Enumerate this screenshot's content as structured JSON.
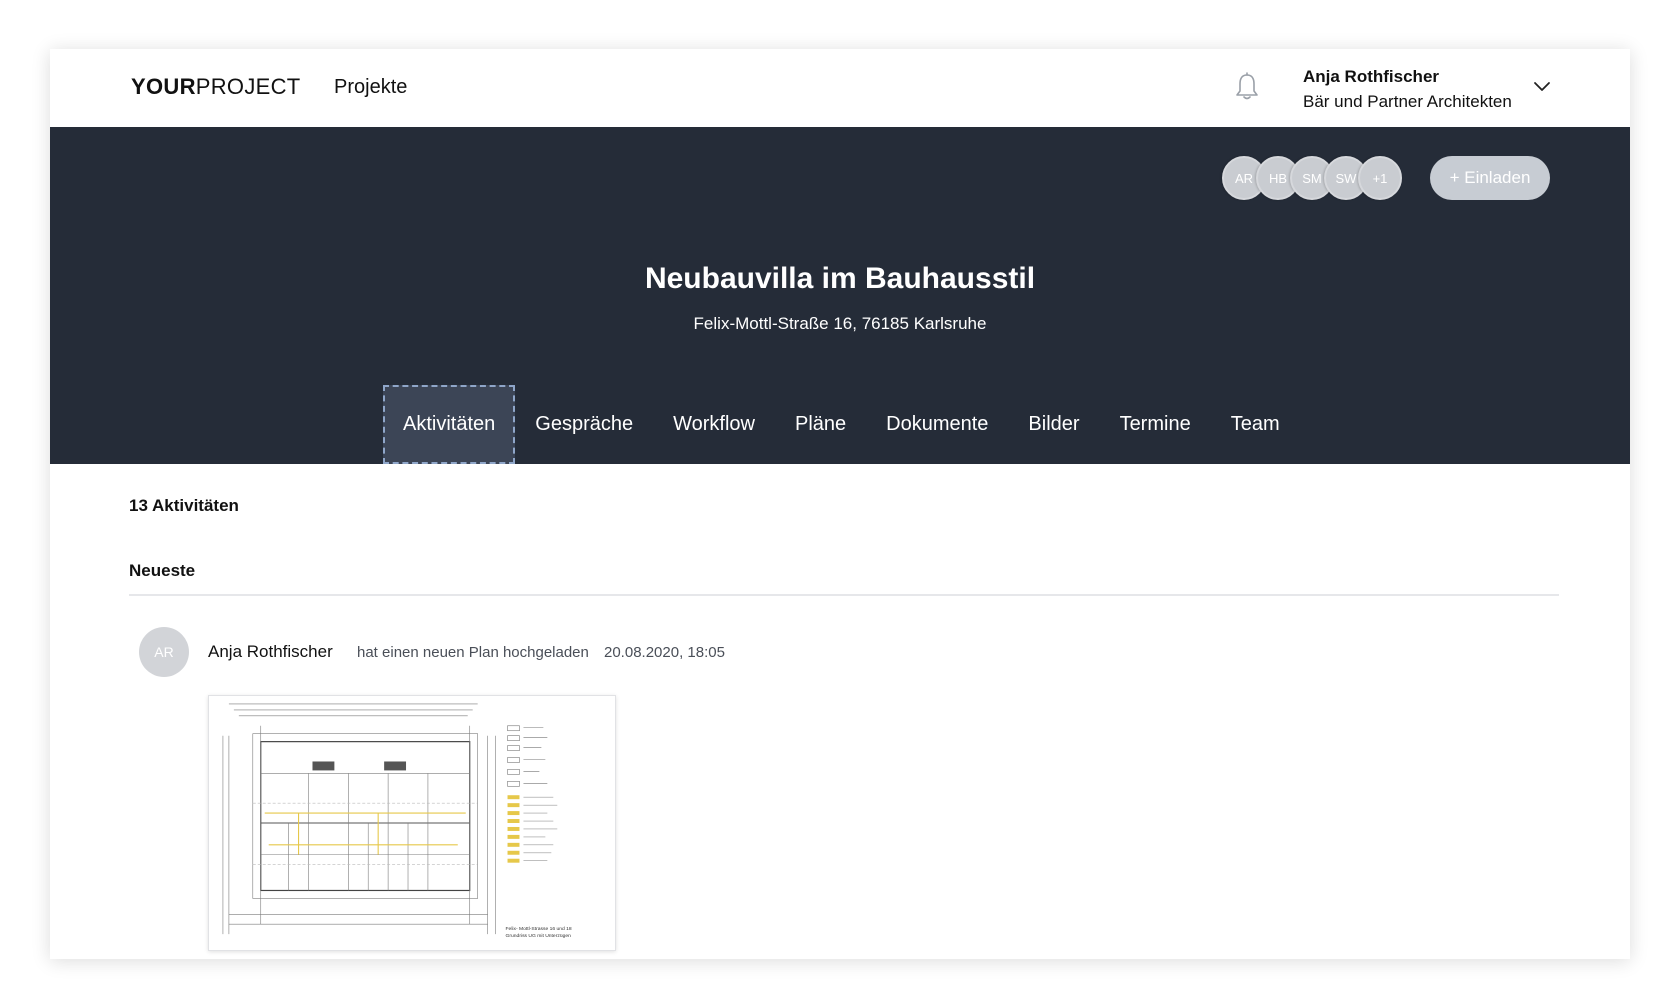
{
  "header": {
    "logo_strong": "YOUR",
    "logo_light": "PROJECT",
    "nav_projects": "Projekte",
    "user_name": "Anja Rothfischer",
    "user_company": "Bär und Partner Architekten"
  },
  "hero": {
    "members": [
      "AR",
      "HB",
      "SM",
      "SW",
      "+1"
    ],
    "invite_label": "+ Einladen",
    "title": "Neubauvilla im Bauhausstil",
    "address": "Felix-Mottl-Straße 16, 76185 Karlsruhe",
    "tabs": [
      "Aktivitäten",
      "Gespräche",
      "Workflow",
      "Pläne",
      "Dokumente",
      "Bilder",
      "Termine",
      "Team"
    ],
    "active_tab": "Aktivitäten"
  },
  "content": {
    "count_label": "13 Aktivitäten",
    "sort_label": "Neueste",
    "activity": {
      "avatar": "AR",
      "user": "Anja Rothfischer",
      "text": "hat einen neuen Plan hochgeladen",
      "time": "20.08.2020, 18:05",
      "plan_caption_1": "Felix- Mottl-Strasse 16 und 18",
      "plan_caption_2": "Grundriss UG mit Unterzügen"
    }
  },
  "colors": {
    "hero_bg": "#252c38",
    "active_tab_bg": "#3c4556",
    "avatar_bg": "#c9ccd1",
    "invite_bg": "#c7ccd3"
  }
}
